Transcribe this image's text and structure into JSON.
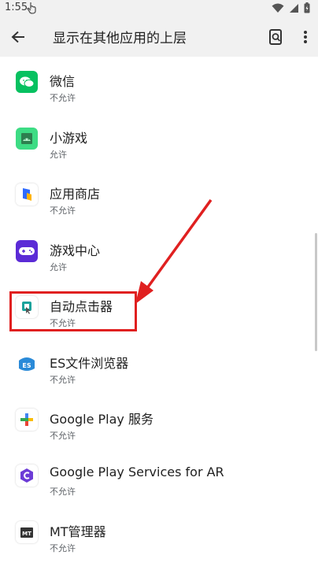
{
  "status_bar": {
    "time": "1:55"
  },
  "app_bar": {
    "title": "显示在其他应用的上层",
    "back_icon": "arrow-back-icon",
    "search_icon": "search-settings-icon",
    "more_icon": "more-vert-icon"
  },
  "apps": [
    {
      "name": "微信",
      "status": "不允许",
      "icon": "wechat-icon",
      "color": "#07c160"
    },
    {
      "name": "小游戏",
      "status": "允许",
      "icon": "android-icon",
      "color": "#3ddc84"
    },
    {
      "name": "应用商店",
      "status": "不允许",
      "icon": "app-store-icon",
      "color": "#2f6bff"
    },
    {
      "name": "游戏中心",
      "status": "允许",
      "icon": "gamepad-icon",
      "color": "#5b2bd6"
    },
    {
      "name": "自动点击器",
      "status": "不允许",
      "icon": "auto-clicker-icon",
      "color": "#1ba39c"
    },
    {
      "name": "ES文件浏览器",
      "status": "不允许",
      "icon": "es-file-explorer-icon",
      "color": "#2a8ad8"
    },
    {
      "name": "Google Play 服务",
      "status": "不允许",
      "icon": "google-play-services-icon",
      "color": "#34a853"
    },
    {
      "name": "Google Play Services for AR",
      "status": "不允许",
      "icon": "ar-core-icon",
      "color": "#6c3bd6"
    },
    {
      "name": "MT管理器",
      "status": "不允许",
      "icon": "mt-manager-icon",
      "color": "#333333"
    }
  ],
  "colors": {
    "highlight": "#e02020",
    "app_bar_bg": "#f1f1f1"
  }
}
